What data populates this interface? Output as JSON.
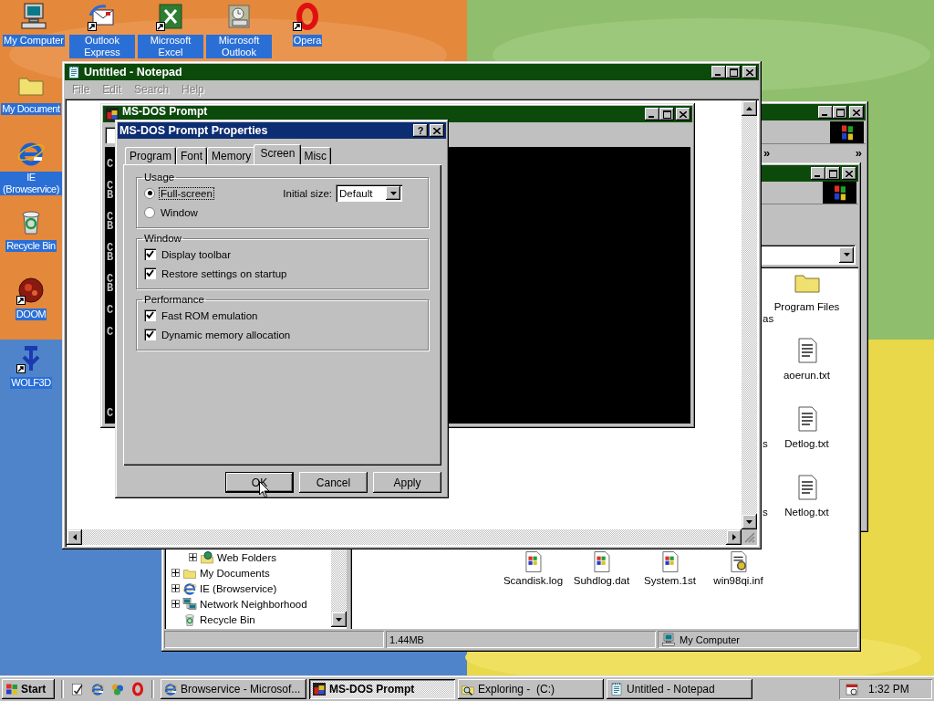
{
  "desktop_icons": [
    {
      "label": "My Computer",
      "kind": "computer",
      "shortcut": false,
      "selected": true
    },
    {
      "label": "Outlook Express",
      "kind": "mail",
      "shortcut": true,
      "selected": true
    },
    {
      "label": "Microsoft Excel",
      "kind": "excel",
      "shortcut": true,
      "selected": true
    },
    {
      "label": "Microsoft Outlook",
      "kind": "outlook",
      "shortcut": false,
      "selected": true
    },
    {
      "label": "Opera",
      "kind": "opera",
      "shortcut": true,
      "selected": true
    },
    {
      "label": "My Document",
      "kind": "folder",
      "shortcut": false,
      "selected": true
    },
    {
      "label": "IE (Browservice)",
      "kind": "ie",
      "shortcut": false,
      "selected": true
    },
    {
      "label": "Recycle Bin",
      "kind": "recycle",
      "shortcut": false,
      "selected": true
    },
    {
      "label": "DOOM",
      "kind": "doom",
      "shortcut": true,
      "selected": true
    },
    {
      "label": "WOLF3D",
      "kind": "wolf",
      "shortcut": true,
      "selected": true
    }
  ],
  "browser_window": {
    "chevrons": [
      "»",
      "»"
    ]
  },
  "explorer": {
    "tree": [
      {
        "children": [
          {
            "label": "Web Folders",
            "kind": "webfolder",
            "expanded": false
          }
        ]
      },
      {
        "label": "My Documents",
        "kind": "folder",
        "expanded": false
      },
      {
        "label": "IE (Browservice)",
        "kind": "ie",
        "expanded": false
      },
      {
        "label": "Network Neighborhood",
        "kind": "network",
        "expanded": false
      },
      {
        "label": "Recycle Bin",
        "kind": "recycle"
      }
    ],
    "files_column": [
      {
        "name": "Program Files",
        "kind": "folder"
      },
      {
        "name": "aoerun.txt",
        "kind": "text"
      },
      {
        "name": "Detlog.txt",
        "kind": "text"
      },
      {
        "name": "Netlog.txt",
        "kind": "text"
      }
    ],
    "files_row": [
      {
        "name": "Scandisk.log",
        "kind": "winfile"
      },
      {
        "name": "Suhdlog.dat",
        "kind": "winfile"
      },
      {
        "name": "System.1st",
        "kind": "winfile"
      },
      {
        "name": "win98qi.inf",
        "kind": "inf"
      }
    ],
    "cut_labels": [
      "as",
      "s",
      "s"
    ],
    "status": [
      {
        "text": "1.44MB"
      },
      {
        "text": "My Computer",
        "kind": "computer"
      }
    ]
  },
  "notepad": {
    "title": "Untitled - Notepad",
    "menu": [
      {
        "label": "File",
        "disabled": true
      },
      {
        "label": "Edit",
        "disabled": true
      },
      {
        "label": "Search",
        "disabled": true
      },
      {
        "label": "Help",
        "disabled": true
      }
    ]
  },
  "dos": {
    "title": "MS-DOS Prompt",
    "screen_blocks": [
      [
        "C"
      ],
      [
        "C",
        "B"
      ],
      [
        "C",
        "B"
      ],
      [
        "C",
        "B"
      ],
      [
        "C",
        "B"
      ],
      [
        "C"
      ],
      [
        "C"
      ],
      [
        "C"
      ]
    ]
  },
  "dialog": {
    "title": "MS-DOS Prompt Properties",
    "help_glyph": "?",
    "tabs": [
      {
        "label": "Program",
        "selected": false
      },
      {
        "label": "Font",
        "selected": false
      },
      {
        "label": "Memory",
        "selected": false
      },
      {
        "label": "Screen",
        "selected": true
      },
      {
        "label": "Misc",
        "selected": false
      }
    ],
    "groups": [
      {
        "title": "Usage",
        "kind": "radio",
        "options": [
          {
            "label": "Full-screen",
            "selected": true,
            "focused": true
          },
          {
            "label": "Window",
            "selected": false,
            "focused": false
          }
        ],
        "size_label": "Initial size:",
        "size_value": "Default"
      },
      {
        "title": "Window",
        "kind": "check",
        "options": [
          {
            "label": "Display toolbar",
            "checked": true
          },
          {
            "label": "Restore settings on startup",
            "checked": true
          }
        ]
      },
      {
        "title": "Performance",
        "kind": "check",
        "options": [
          {
            "label": "Fast ROM emulation",
            "checked": true
          },
          {
            "label": "Dynamic memory allocation",
            "checked": true
          }
        ]
      }
    ],
    "buttons": [
      {
        "label": "OK",
        "default": true
      },
      {
        "label": "Cancel",
        "default": false
      },
      {
        "label": "Apply",
        "default": false
      }
    ]
  },
  "taskbar": {
    "start": "Start",
    "quick_launch": [
      {
        "kind": "note"
      },
      {
        "kind": "ie"
      },
      {
        "kind": "channels"
      },
      {
        "kind": "opera"
      }
    ],
    "tasks": [
      {
        "label": "Browservice - Microsof...",
        "kind": "ie",
        "selected": false
      },
      {
        "label": "MS-DOS Prompt",
        "kind": "dos",
        "selected": true
      },
      {
        "label": "Exploring -  (C:)",
        "kind": "explore",
        "selected": false
      },
      {
        "label": "Untitled - Notepad",
        "kind": "notepad",
        "selected": false
      }
    ],
    "clock": "1:32 PM"
  }
}
